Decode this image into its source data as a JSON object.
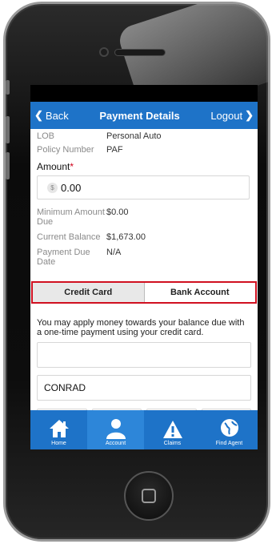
{
  "nav": {
    "back_label": "Back",
    "title": "Payment Details",
    "logout_label": "Logout"
  },
  "policy": {
    "lob_label": "LOB",
    "lob_value": "Personal Auto",
    "policy_number_label": "Policy Number",
    "policy_number_value": "PAF"
  },
  "amount": {
    "label": "Amount",
    "required_mark": "*",
    "currency_symbol": "$",
    "value": "0.00"
  },
  "info": {
    "minimum_label": "Minimum Amount Due",
    "minimum_value": "$0.00",
    "balance_label": "Current Balance",
    "balance_value": "$1,673.00",
    "due_date_label": "Payment Due Date",
    "due_date_value": "N/A"
  },
  "tabs": {
    "credit_card": "Credit Card",
    "bank_account": "Bank Account",
    "selected": "Credit Card"
  },
  "form": {
    "description": "You may apply money towards your balance due with a one-time payment using your credit card.",
    "card_number_value": "",
    "name_value": "CONRAD"
  },
  "tabbar": {
    "items": [
      {
        "label": "Home",
        "icon": "home-icon"
      },
      {
        "label": "Account",
        "icon": "account-icon"
      },
      {
        "label": "Claims",
        "icon": "claims-icon"
      },
      {
        "label": "Find Agent",
        "icon": "find-agent-icon"
      }
    ],
    "active": "Account"
  },
  "colors": {
    "accent": "#1e73c8",
    "highlight_border": "#d01020",
    "required": "#d0021b"
  }
}
